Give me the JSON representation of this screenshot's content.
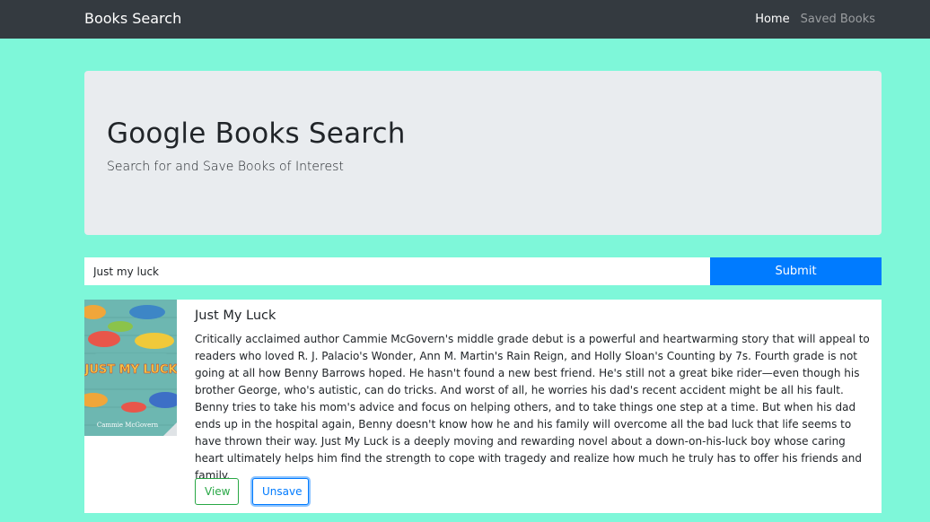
{
  "navbar": {
    "brand": "Books Search",
    "links": [
      {
        "label": "Home",
        "active": true
      },
      {
        "label": "Saved Books",
        "active": false
      }
    ]
  },
  "jumbotron": {
    "title": "Google Books Search",
    "subtitle": "Search for and Save Books of Interest"
  },
  "search": {
    "value": "Just my luck",
    "submit_label": "Submit"
  },
  "result": {
    "cover_text": {
      "title": "JUST MY LUCK",
      "author": "Cammie McGovern"
    },
    "title": "Just My Luck",
    "description": "Critically acclaimed author Cammie McGovern's middle grade debut is a powerful and heartwarming story that will appeal to readers who loved R. J. Palacio's Wonder, Ann M. Martin's Rain Reign, and Holly Sloan's Counting by 7s. Fourth grade is not going at all how Benny Barrows hoped. He hasn't found a new best friend. He's still not a great bike rider—even though his brother George, who's autistic, can do tricks. And worst of all, he worries his dad's recent accident might be all his fault. Benny tries to take his mom's advice and focus on helping others, and to take things one step at a time. But when his dad ends up in the hospital again, Benny doesn't know how he and his family will overcome all the bad luck that life seems to have thrown their way. Just My Luck is a deeply moving and rewarding novel about a down-on-his-luck boy whose caring heart ultimately helps him find the strength to cope with tragedy and realize how much he truly has to offer his friends and family.",
    "view_label": "View",
    "unsave_label": "Unsave"
  },
  "colors": {
    "page_bg": "#7ef7d9",
    "navbar_bg": "#343a40",
    "jumbotron_bg": "#e9ecef",
    "primary": "#007bff",
    "success": "#28a745"
  }
}
